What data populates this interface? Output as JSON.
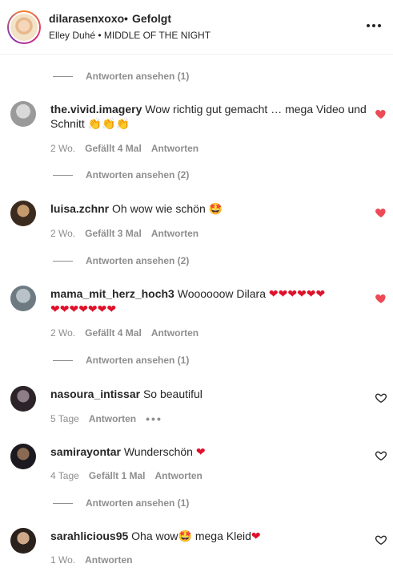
{
  "header": {
    "username": "dilarasenxoxo",
    "separator": "•",
    "follow_state": "Gefolgt",
    "song": "Elley Duhé • MIDDLE OF THE NIGHT",
    "more_icon": "more-horizontal-icon"
  },
  "reply_label": "Antworten ansehen",
  "replies": [
    {
      "text": "Antworten ansehen (1)"
    },
    {
      "text": "Antworten ansehen (2)"
    },
    {
      "text": "Antworten ansehen (2)"
    },
    {
      "text": "Antworten ansehen (1)"
    },
    {
      "text": "Antworten ansehen (1)"
    }
  ],
  "comments": [
    {
      "user": "the.vivid.imagery",
      "text": "Wow richtig gut gemacht … mega Video und Schnitt",
      "emoji": "👏👏👏",
      "time": "2 Wo.",
      "likes": "Gefällt 4 Mal",
      "reply": "Antworten",
      "liked": true,
      "avatar_colors": [
        "#d9d9d9",
        "#9a9a9a"
      ]
    },
    {
      "user": "luisa.zchnr",
      "text": "Oh wow wie schön",
      "emoji": "🤩",
      "time": "2 Wo.",
      "likes": "Gefällt 3 Mal",
      "reply": "Antworten",
      "liked": true,
      "avatar_colors": [
        "#c49a6c",
        "#3b2a1e"
      ]
    },
    {
      "user": "mama_mit_herz_hoch3",
      "text": "Woooooow Dilara",
      "emoji_line1": "❤❤❤❤❤❤",
      "emoji_line2": "❤❤❤❤❤❤❤",
      "time": "2 Wo.",
      "likes": "Gefällt 4 Mal",
      "reply": "Antworten",
      "liked": true,
      "avatar_colors": [
        "#b9c2c8",
        "#6d7a82"
      ]
    },
    {
      "user": "nasoura_intissar",
      "text": "So beautiful",
      "time": "5 Tage",
      "reply": "Antworten",
      "more": "•••",
      "liked": false,
      "avatar_colors": [
        "#8e7c86",
        "#2b2328"
      ]
    },
    {
      "user": "samirayontar",
      "text": "Wunderschön",
      "emoji": "❤",
      "time": "4 Tage",
      "likes": "Gefällt 1 Mal",
      "reply": "Antworten",
      "liked": false,
      "avatar_colors": [
        "#8a6a52",
        "#1c1a20"
      ]
    },
    {
      "user": "sarahlicious95",
      "text": "Oha wow",
      "emoji": "🤩",
      "text2": "mega Kleid",
      "emoji2": "❤",
      "time": "1 Wo.",
      "reply": "Antworten",
      "liked": false,
      "avatar_colors": [
        "#cfa88a",
        "#2a211c"
      ]
    }
  ],
  "colors": {
    "accent_heart": "#ed4956",
    "muted": "#8e8e8e",
    "text": "#262626"
  }
}
